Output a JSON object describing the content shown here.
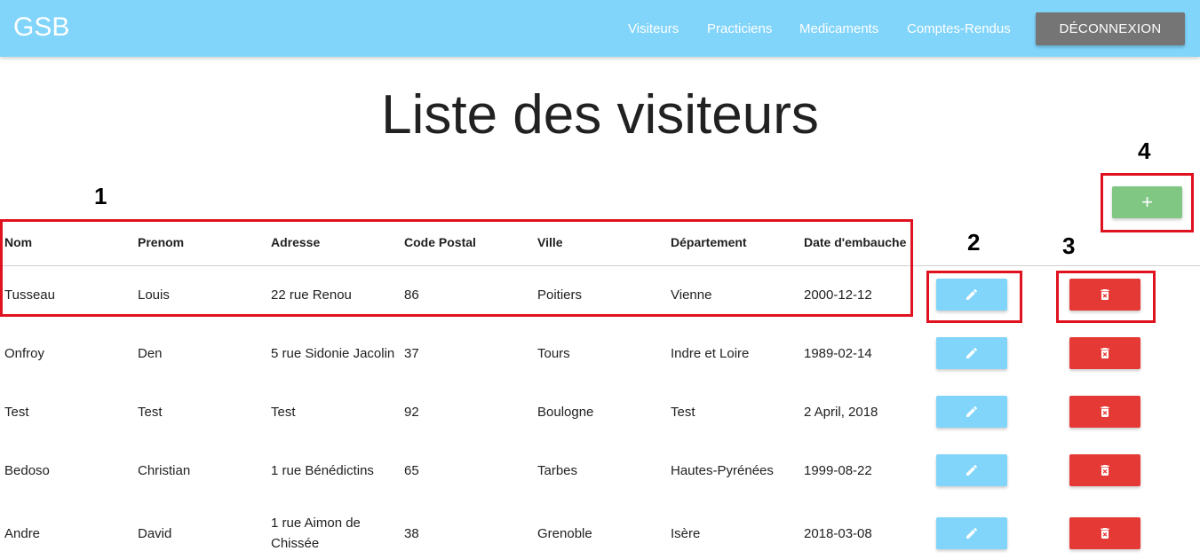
{
  "navbar": {
    "brand": "GSB",
    "links": [
      "Visiteurs",
      "Practiciens",
      "Medicaments",
      "Comptes-Rendus"
    ],
    "logout_label": "DÉCONNEXION"
  },
  "page_title": "Liste des visiteurs",
  "add_button_label": "+",
  "table": {
    "headers": [
      "Nom",
      "Prenom",
      "Adresse",
      "Code Postal",
      "Ville",
      "Département",
      "Date d'embauche"
    ],
    "rows": [
      [
        "Tusseau",
        "Louis",
        "22 rue Renou",
        "86",
        "Poitiers",
        "Vienne",
        "2000-12-12"
      ],
      [
        "Onfroy",
        "Den",
        "5 rue Sidonie Jacolin",
        "37",
        "Tours",
        "Indre et Loire",
        "1989-02-14"
      ],
      [
        "Test",
        "Test",
        "Test",
        "92",
        "Boulogne",
        "Test",
        "2 April, 2018"
      ],
      [
        "Bedoso",
        "Christian",
        "1 rue Bénédictins",
        "65",
        "Tarbes",
        "Hautes-Pyrénées",
        "1999-08-22"
      ],
      [
        "Andre",
        "David",
        "1 rue Aimon de Chissée",
        "38",
        "Grenoble",
        "Isère",
        "2018-03-08"
      ]
    ]
  },
  "annotations": [
    "1",
    "2",
    "3",
    "4"
  ],
  "icons": {
    "edit": "pencil-icon",
    "delete": "trash-icon"
  },
  "colors": {
    "navbar": "#81d4fa",
    "logout": "#757575",
    "add": "#81c784",
    "edit": "#81d4fa",
    "delete": "#e53935",
    "annotation": "#e0121f"
  }
}
